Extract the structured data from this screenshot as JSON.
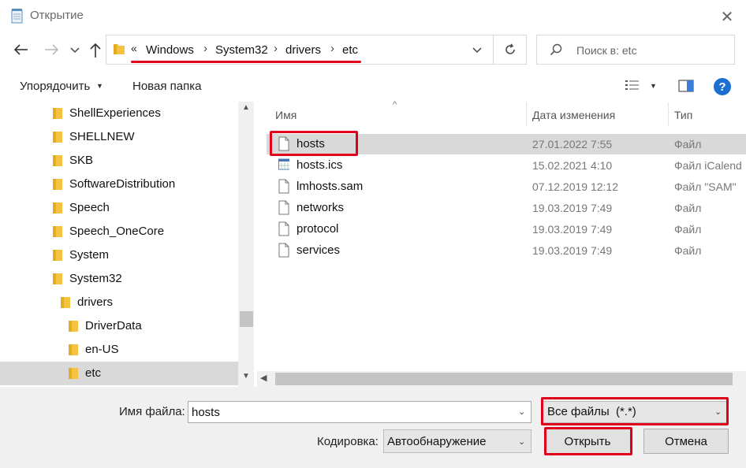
{
  "window": {
    "title": "Открытие",
    "close_glyph": "✕"
  },
  "address": {
    "overflow": "«",
    "crumbs": [
      "Windows",
      "System32",
      "drivers",
      "etc"
    ],
    "separator": "›",
    "search_placeholder": "Поиск в: etc"
  },
  "toolbar": {
    "organize": "Упорядочить",
    "new_folder": "Новая папка",
    "help": "?"
  },
  "tree": {
    "items": [
      {
        "label": "ShellExperiences",
        "level": 0
      },
      {
        "label": "SHELLNEW",
        "level": 0
      },
      {
        "label": "SKB",
        "level": 0
      },
      {
        "label": "SoftwareDistribution",
        "level": 0
      },
      {
        "label": "Speech",
        "level": 0
      },
      {
        "label": "Speech_OneCore",
        "level": 0
      },
      {
        "label": "System",
        "level": 0
      },
      {
        "label": "System32",
        "level": 0
      },
      {
        "label": "drivers",
        "level": 1
      },
      {
        "label": "DriverData",
        "level": 2
      },
      {
        "label": "en-US",
        "level": 2
      },
      {
        "label": "etc",
        "level": 2,
        "selected": true
      }
    ]
  },
  "list": {
    "columns": {
      "name": "Имя",
      "date": "Дата изменения",
      "type": "Тип"
    },
    "files": [
      {
        "name": "hosts",
        "date": "27.01.2022 7:55",
        "type": "Файл",
        "icon": "blank-file-icon",
        "selected": true
      },
      {
        "name": "hosts.ics",
        "date": "15.02.2021 4:10",
        "type": "Файл iCalend",
        "icon": "calendar-file-icon"
      },
      {
        "name": "lmhosts.sam",
        "date": "07.12.2019 12:12",
        "type": "Файл \"SAM\"",
        "icon": "blank-file-icon"
      },
      {
        "name": "networks",
        "date": "19.03.2019 7:49",
        "type": "Файл",
        "icon": "blank-file-icon"
      },
      {
        "name": "protocol",
        "date": "19.03.2019 7:49",
        "type": "Файл",
        "icon": "blank-file-icon"
      },
      {
        "name": "services",
        "date": "19.03.2019 7:49",
        "type": "Файл",
        "icon": "blank-file-icon"
      }
    ]
  },
  "bottom": {
    "filename_label": "Имя файла:",
    "filename_value": "hosts",
    "filter_value": "Все файлы  (*.*)",
    "encoding_label": "Кодировка:",
    "encoding_value": "Автообнаружение",
    "open_label": "Открыть",
    "cancel_label": "Отмена"
  },
  "colors": {
    "highlight": "#e0001b",
    "folder": "#f5c342",
    "selection": "#d9d9d9",
    "help_blue": "#1a6fd1"
  }
}
